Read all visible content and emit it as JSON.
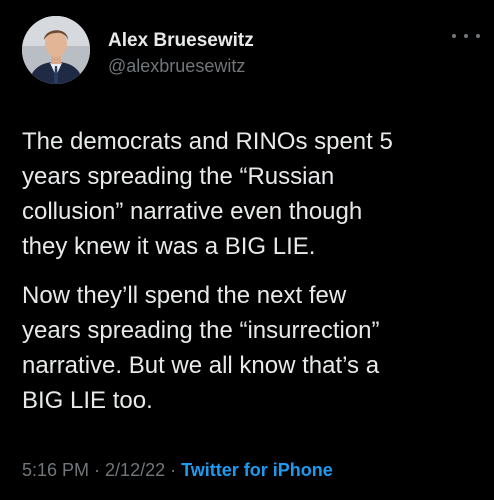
{
  "user": {
    "name": "Alex Bruesewitz",
    "handle": "@alexbruesewitz"
  },
  "tweet": {
    "paragraph1": "The democrats and RINOs spent 5\nyears spreading the “Russian\ncollusion” narrative even though\nthey knew it was a BIG LIE.",
    "paragraph2": "Now they’ll spend the next few\nyears spreading the “insurrection”\nnarrative. But we all know that’s a\nBIG LIE too."
  },
  "meta": {
    "time": "5:16 PM",
    "separator1": " · ",
    "date": "2/12/22",
    "separator2": " · ",
    "source": "Twitter for iPhone"
  },
  "colors": {
    "background": "#000000",
    "text": "#e7e9ea",
    "muted": "#71767b",
    "link": "#1d9bf0"
  },
  "icons": {
    "more": "more-dots-icon"
  }
}
